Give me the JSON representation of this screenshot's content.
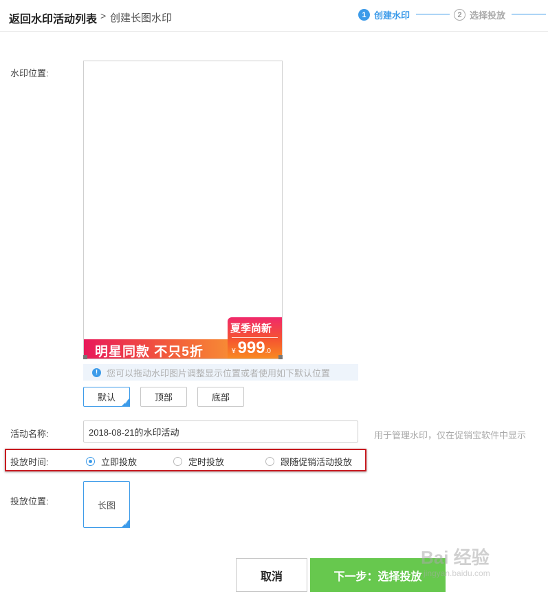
{
  "header": {
    "back_link": "返回水印活动列表",
    "separator": ">",
    "current_page": "创建长图水印",
    "steps": [
      {
        "num": "1",
        "label": "创建水印"
      },
      {
        "num": "2",
        "label": "选择投放"
      }
    ]
  },
  "colors": {
    "accent": "#3d9be9",
    "confirm": "#67c84e",
    "highlight": "#c8191f"
  },
  "position": {
    "label": "水印位置:",
    "watermark": {
      "banner_text": "明星同款 不只5折",
      "badge_title": "夏季尚新",
      "currency": "¥",
      "price": "999",
      "price_suffix": ".0"
    },
    "hint": "您可以拖动水印图片调整显示位置或者使用如下默认位置",
    "buttons": [
      "默认",
      "顶部",
      "底部"
    ],
    "selected": "默认"
  },
  "activity_name": {
    "label": "活动名称:",
    "value": "2018-08-21的水印活动",
    "help": "用于管理水印，仅在促销宝软件中显示"
  },
  "schedule": {
    "label": "投放时间:",
    "options": [
      "立即投放",
      "定时投放",
      "跟随促销活动投放"
    ],
    "selected": "立即投放"
  },
  "placement": {
    "label": "投放位置:",
    "tile": "长图"
  },
  "actions": {
    "cancel": "取消",
    "next": "下一步：选择投放"
  },
  "site_watermark": {
    "logo": "Bai 经验",
    "url": "jingyan.baidu.com"
  }
}
